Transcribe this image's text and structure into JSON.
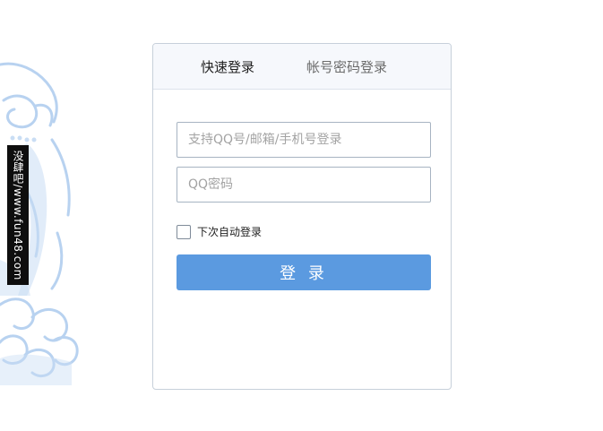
{
  "tabs": {
    "quick_login": "快速登录",
    "password_login": "帐号密码登录"
  },
  "form": {
    "account_placeholder": "支持QQ号/邮箱/手机号登录",
    "password_placeholder": "QQ密码",
    "remember_label": "下次自动登录",
    "login_button": "登 录"
  },
  "watermark": {
    "text": "没肆吧/www.fun48.com"
  },
  "colors": {
    "login_button": "#5b9ae0",
    "tab_bar": "#f6f8fc",
    "decoration": "#b8d2f0"
  }
}
